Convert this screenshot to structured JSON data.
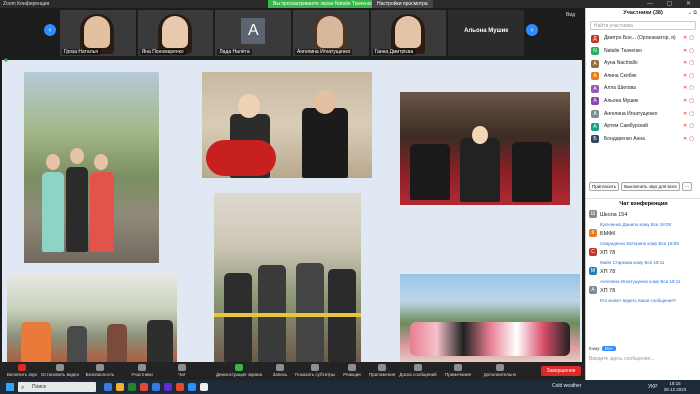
{
  "window": {
    "title": "Zoom Конференция",
    "share_banner": "Вы просматриваете экран Natalie Ткаченко",
    "view_settings": "Настройки просмотра",
    "controls": "— ▢ ✕"
  },
  "strip": {
    "view_label": "Вид",
    "prev_arrow": "‹",
    "next_arrow": "›",
    "tiles": [
      {
        "name": "Гроза Наталья",
        "type": "video",
        "skin": "#e3c0a0"
      },
      {
        "name": "Яна Пономаренко",
        "type": "video",
        "skin": "#e8c9ae"
      },
      {
        "name": "Лада Налёта",
        "type": "avatar",
        "letter": "A"
      },
      {
        "name": "Ангелина Игнатущенко",
        "type": "video",
        "skin": "#d9b79b"
      },
      {
        "name": "Ганна Дмитрієва",
        "type": "video",
        "skin": "#e4c4a6"
      },
      {
        "name": "Альона Мушик",
        "type": "name_only"
      }
    ]
  },
  "toolbar": {
    "buttons": [
      {
        "label": "Включить звук",
        "icon": "mic-muted-icon",
        "color": "red"
      },
      {
        "label": "Остановить видео",
        "icon": "video-camera-icon",
        "color": "gray"
      },
      {
        "label": "Безопасность",
        "icon": "shield-icon",
        "color": "gray"
      },
      {
        "label": "Участники",
        "icon": "participants-icon",
        "color": "gray"
      },
      {
        "label": "Чат",
        "icon": "chat-icon",
        "color": "gray"
      },
      {
        "label": "Демонстрация экрана",
        "icon": "share-screen-icon",
        "color": "green"
      },
      {
        "label": "Запись",
        "icon": "record-icon",
        "color": "gray"
      },
      {
        "label": "Показать субтитры",
        "icon": "captions-icon",
        "color": "gray"
      },
      {
        "label": "Реакции",
        "icon": "reactions-icon",
        "color": "gray"
      },
      {
        "label": "Приложения",
        "icon": "apps-icon",
        "color": "gray"
      },
      {
        "label": "Доска сообщений",
        "icon": "whiteboard-icon",
        "color": "gray"
      },
      {
        "label": "Примечания",
        "icon": "notes-icon",
        "color": "gray"
      },
      {
        "label": "Дополнительно",
        "icon": "more-icon",
        "color": "gray"
      }
    ],
    "end_label": "Завершение"
  },
  "participants": {
    "header": "Участники (38)",
    "search_placeholder": "Найти участника",
    "list": [
      {
        "name": "Дмитро Бон... (Организатор, я)",
        "color": "#c0392b",
        "letter": "Д"
      },
      {
        "name": "Natalie Ткаченко",
        "color": "#27ae60",
        "letter": "N"
      },
      {
        "name": "Aуна Nachtallo",
        "color": "#8e6e3e",
        "letter": "A"
      },
      {
        "name": "Алина Скобяк",
        "color": "#e67e22",
        "letter": "A"
      },
      {
        "name": "Алла Шилова",
        "color": "#9b59b6",
        "letter": "A"
      },
      {
        "name": "Альона Мушик",
        "color": "#8e44ad",
        "letter": "A"
      },
      {
        "name": "Ангелина Игнатущенко",
        "color": "#7f8c8d",
        "letter": "A"
      },
      {
        "name": "Артем Самбурский",
        "color": "#16a085",
        "letter": "A"
      },
      {
        "name": "Бондаренко Анна",
        "color": "#34495e",
        "letter": "Б"
      }
    ],
    "invite_label": "Пригласить",
    "mute_all_label": "Выключить звук для всех",
    "more_label": "···"
  },
  "chat": {
    "header": "Чат конференции",
    "messages": [
      {
        "type": "text",
        "text": "Школа 154",
        "color": "#7f8c8d",
        "letter": "Ш"
      },
      {
        "type": "meta",
        "text": "Кульченко Данило кому Все 18:08"
      },
      {
        "type": "text",
        "text": "БМФК",
        "color": "#e67e22",
        "letter": "К"
      },
      {
        "type": "meta",
        "text": "Свириденко Катерина кому Все 18:09"
      },
      {
        "type": "text",
        "text": "ХП 78",
        "color": "#c0392b",
        "letter": "С"
      },
      {
        "type": "meta",
        "text": "Майя Старкова кому Все 18:11"
      },
      {
        "type": "text",
        "text": "ХП 78",
        "color": "#2980b9",
        "letter": "M"
      },
      {
        "type": "meta",
        "text": "Ангелина Игнатущенко кому Все 18:11"
      },
      {
        "type": "text",
        "text": "ХП 78",
        "color": "#7f8c8d",
        "letter": "A"
      },
      {
        "type": "meta",
        "text": "Кто может видеть ваши сообщения?"
      }
    ],
    "to_label": "Кому:",
    "to_value": "Все",
    "input_placeholder": "Введите здесь сообщение..."
  },
  "taskbar": {
    "search_placeholder": "Поиск",
    "weather": "Cold weather",
    "lang": "УКР",
    "time": "18:15",
    "date": "28.12.2023",
    "apps": [
      "#3c7dd9",
      "#f3b32a",
      "#2f7d32",
      "#e24a3b",
      "#3b78e7",
      "#5d2ed6",
      "#e34b2f",
      "#2d8cff",
      "#fff"
    ]
  }
}
